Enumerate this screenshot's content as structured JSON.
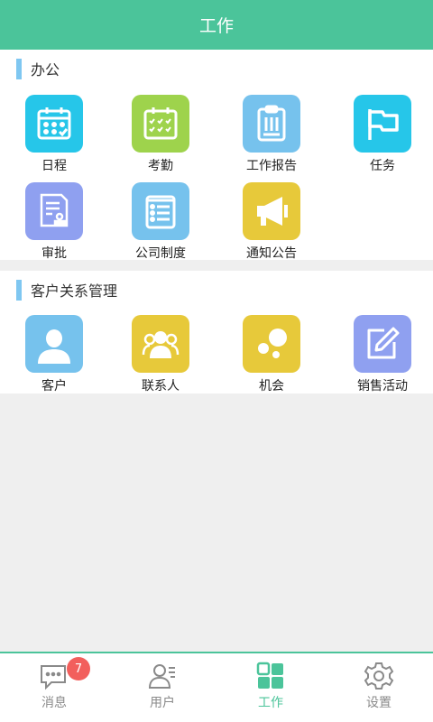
{
  "header": {
    "title": "工作"
  },
  "office": {
    "title": "办公",
    "items": [
      {
        "label": "日程",
        "icon": "calendar-icon",
        "color": "#26c6e9"
      },
      {
        "label": "考勤",
        "icon": "attendance-icon",
        "color": "#9ed34c"
      },
      {
        "label": "工作报告",
        "icon": "report-icon",
        "color": "#76c2ed"
      },
      {
        "label": "任务",
        "icon": "flag-icon",
        "color": "#26c6e9"
      },
      {
        "label": "审批",
        "icon": "approval-icon",
        "color": "#8fa0f0"
      },
      {
        "label": "公司制度",
        "icon": "policy-list-icon",
        "color": "#76c2ed"
      },
      {
        "label": "通知公告",
        "icon": "megaphone-icon",
        "color": "#e7c93a"
      }
    ]
  },
  "crm": {
    "title": "客户关系管理",
    "items": [
      {
        "label": "客户",
        "icon": "customer-icon",
        "color": "#76c2ed"
      },
      {
        "label": "联系人",
        "icon": "contacts-icon",
        "color": "#e7c93a"
      },
      {
        "label": "机会",
        "icon": "opportunity-icon",
        "color": "#e7c93a"
      },
      {
        "label": "销售活动",
        "icon": "edit-icon",
        "color": "#8fa0f0"
      }
    ]
  },
  "tabbar": {
    "active_color": "#4bc49a",
    "tabs": [
      {
        "label": "消息",
        "icon": "message-icon",
        "badge": "7"
      },
      {
        "label": "用户",
        "icon": "user-icon"
      },
      {
        "label": "工作",
        "icon": "work-grid-icon",
        "active": true
      },
      {
        "label": "设置",
        "icon": "gear-icon"
      }
    ]
  }
}
